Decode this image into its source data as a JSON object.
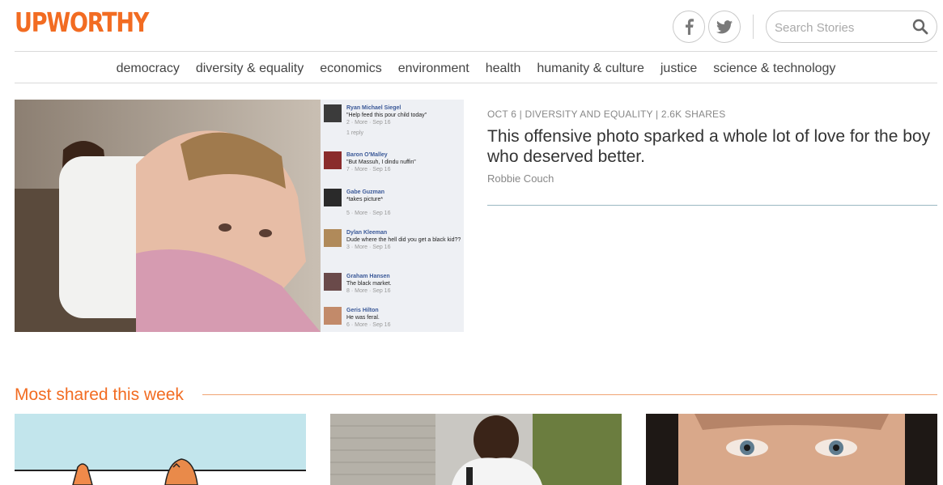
{
  "header": {
    "logo": "UPWORTHY",
    "search_placeholder": "Search Stories"
  },
  "nav": {
    "items": [
      "democracy",
      "diversity & equality",
      "economics",
      "environment",
      "health",
      "humanity & culture",
      "justice",
      "science & technology"
    ]
  },
  "hero": {
    "meta": "OCT 6 | DIVERSITY AND EQUALITY | 2.6K SHARES",
    "title": "This offensive photo sparked a whole lot of love for the boy who deserved better.",
    "author": "Robbie Couch",
    "comments": [
      {
        "name": "Ryan Michael Siegel",
        "text": "\"Help feed this pour child today\"",
        "meta": "2 · More · Sep 16",
        "extra": "1 reply"
      },
      {
        "name": "Baron O'Malley",
        "text": "\"But Massuh, I dindu nuffin\"",
        "meta": "7 · More · Sep 16"
      },
      {
        "name": "Gabe Guzman",
        "text": "*takes picture*",
        "meta": "5 · More · Sep 16"
      },
      {
        "name": "Dylan Kleeman",
        "text": "Dude where the hell did you get a black kid??",
        "meta": "3 · More · Sep 16"
      },
      {
        "name": "Graham Hansen",
        "text": "The black market.",
        "meta": "8 · More · Sep 16"
      },
      {
        "name": "Geris Hilton",
        "text": "He was feral.",
        "meta": "6 · More · Sep 16"
      }
    ]
  },
  "most_shared": {
    "title": "Most shared this week"
  },
  "colors": {
    "brand": "#f26c22",
    "accent_rule": "#9ab8c2"
  }
}
